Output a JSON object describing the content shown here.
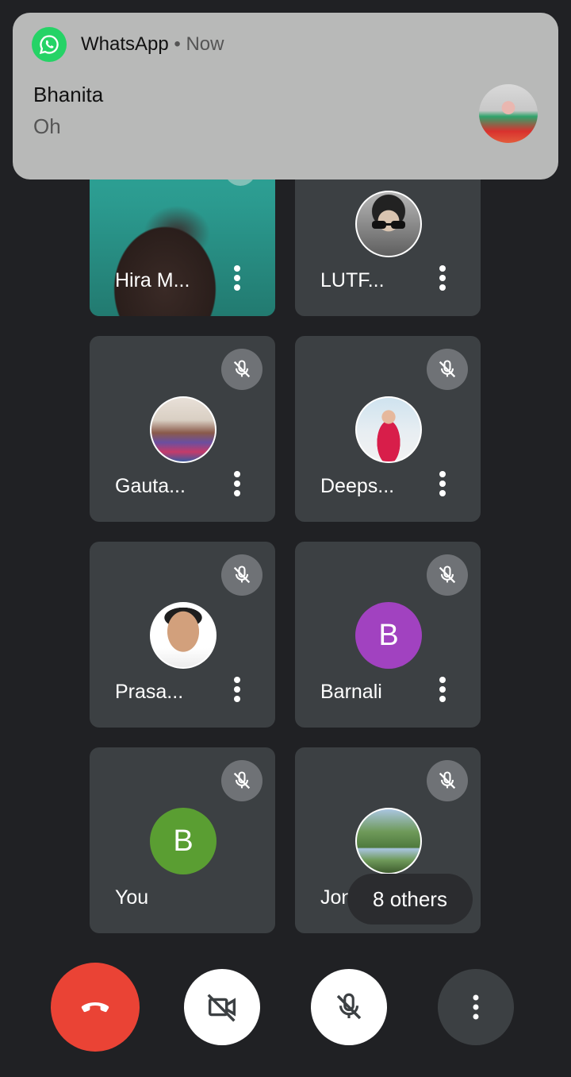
{
  "notification": {
    "app_name": "WhatsApp",
    "separator": "•",
    "time": "Now",
    "sender": "Bhanita",
    "message": "Oh"
  },
  "participants": [
    {
      "name": "Hira M...",
      "type": "video"
    },
    {
      "name": "LUTF...",
      "type": "photo"
    },
    {
      "name": "Gauta...",
      "type": "photo",
      "muted": true
    },
    {
      "name": "Deeps...",
      "type": "photo",
      "muted": true
    },
    {
      "name": "Prasa...",
      "type": "photo",
      "muted": true
    },
    {
      "name": "Barnali",
      "type": "initial",
      "initial": "B",
      "color": "#a142c0",
      "muted": true
    },
    {
      "name": "You",
      "type": "initial",
      "initial": "B",
      "color": "#5a9e32",
      "muted": true
    },
    {
      "name": "Jons...",
      "type": "photo",
      "muted": true
    }
  ],
  "others_count_label": "8 others",
  "controls": {
    "end_call_color": "#ea4335",
    "camera_state": "off",
    "mic_state": "muted"
  },
  "icons": {
    "app": "whatsapp-icon",
    "mute": "mic-off-icon",
    "more": "more-vert-icon",
    "end_call": "call-end-icon",
    "camera": "videocam-off-icon",
    "mic": "mic-off-icon"
  }
}
